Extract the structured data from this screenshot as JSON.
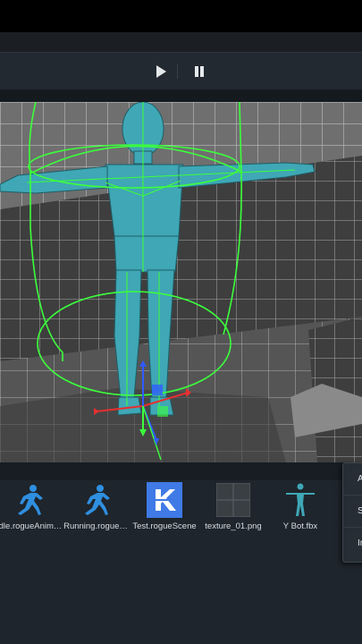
{
  "toolbar": {
    "play_icon": "play-icon",
    "pause_icon": "pause-icon"
  },
  "assets": [
    {
      "label": "Idle.rogueAnimation",
      "display": "Idle.rogueAnim…",
      "icon": "running-figure-icon"
    },
    {
      "label": "Running.rogueAnimation",
      "display": "Running.rogue…",
      "icon": "running-figure-icon"
    },
    {
      "label": "Test.rogueScene",
      "display": "Test.rogueScene",
      "icon": "scene-logo-icon"
    },
    {
      "label": "texture_01.png",
      "display": "texture_01.png",
      "icon": "grid-texture-icon"
    },
    {
      "label": "Y Bot.fbx",
      "display": "Y Bot.fbx",
      "icon": "model-figure-icon"
    }
  ],
  "context_menu": {
    "items": [
      "A",
      "S",
      "In"
    ]
  },
  "colors": {
    "accent_blue": "#2f8fe0",
    "character_teal": "#3fa7b5",
    "collider_green": "#3cff3c"
  }
}
